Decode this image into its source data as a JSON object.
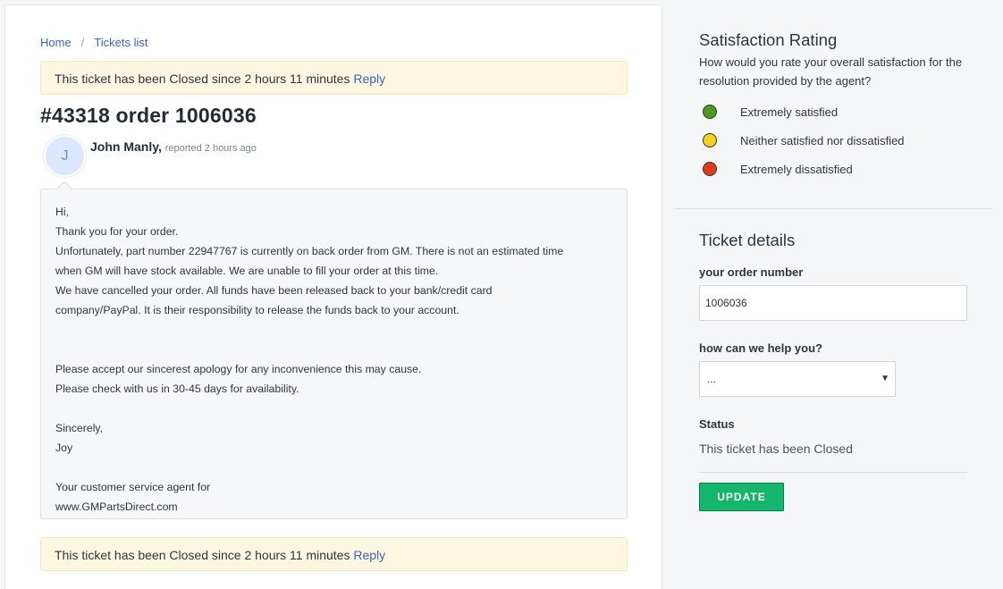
{
  "breadcrumb": {
    "home": "Home",
    "separator": "/",
    "tickets": "Tickets list"
  },
  "notice": {
    "text": "This ticket has been Closed since 2 hours 11 minutes",
    "reply": "Reply"
  },
  "ticket": {
    "title": "#43318 order 1006036"
  },
  "author": {
    "initial": "J",
    "name": "John Manly,",
    "meta": "reported 2 hours ago"
  },
  "message": {
    "lines": [
      "Hi,",
      "Thank you for your order.",
      "Unfortunately, part number 22947767 is currently on back order from GM. There is not an estimated time",
      "when GM will have stock available.   We are unable to fill your order at this time.",
      "We have cancelled your order.  All  funds have been released back to your bank/credit card",
      "company/PayPal.  It is their responsibility to release the funds back to your account.",
      "",
      "",
      "Please accept our sincerest apology for any inconvenience this may cause.",
      "Please check with us in 30-45 days for availability.",
      "",
      "Sincerely,",
      "Joy",
      "",
      "Your customer service agent for",
      "www.GMPartsDirect.com"
    ]
  },
  "rating": {
    "title": "Satisfaction Rating",
    "question": "How would you rate your overall satisfaction for the resolution provided by the agent?",
    "options": [
      {
        "label": "Extremely satisfied",
        "color": "#4c9a1c"
      },
      {
        "label": "Neither satisfied nor dissatisfied",
        "color": "#f2d21b"
      },
      {
        "label": "Extremely dissatisfied",
        "color": "#e03a1e"
      }
    ]
  },
  "details": {
    "title": "Ticket details",
    "order_label": "your order number",
    "order_value": "1006036",
    "help_label": "how can we help you?",
    "help_value": "...",
    "status_label": "Status",
    "status_value": "This ticket has been Closed",
    "update_button": "UPDATE"
  }
}
